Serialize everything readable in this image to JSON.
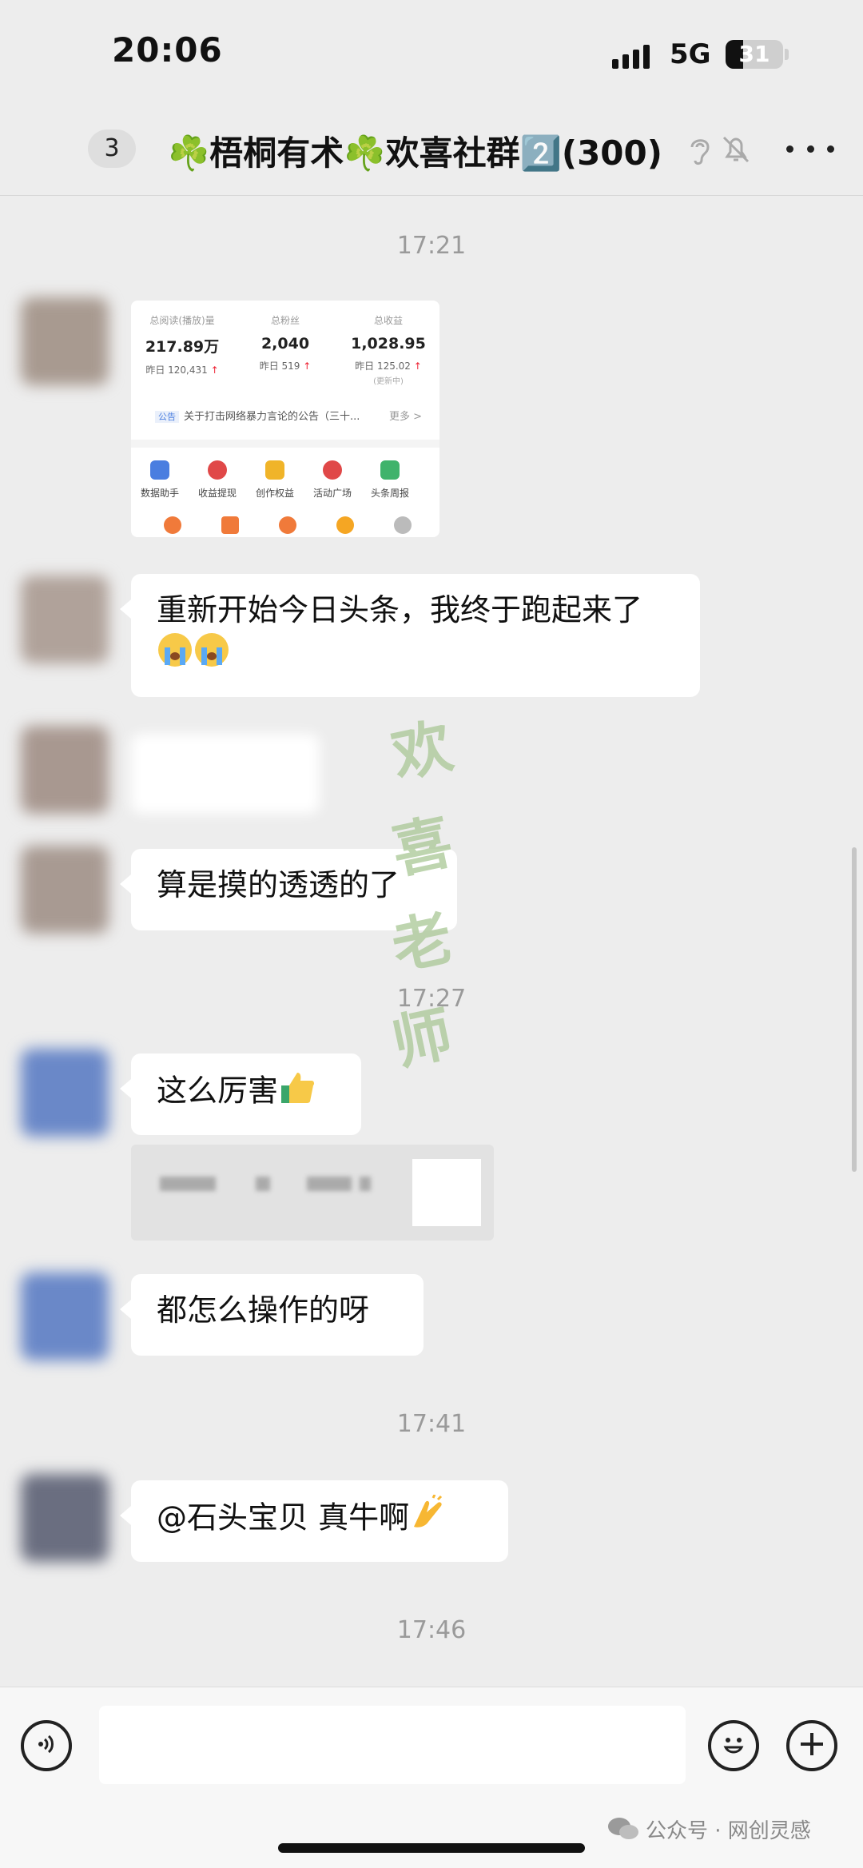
{
  "status_bar": {
    "time": "20:06",
    "network": "5G",
    "battery": "31",
    "battery_level": 0.31
  },
  "header": {
    "back_count": "3",
    "title": "☘️梧桐有术☘️欢喜社群2️⃣(300)"
  },
  "watermark": {
    "chars": [
      "欢",
      "喜",
      "老",
      "师"
    ]
  },
  "chat": {
    "timestamps": [
      "17:21",
      "17:27",
      "17:41",
      "17:46"
    ],
    "screenshot_card": {
      "stats": [
        {
          "label": "总阅读(播放)量",
          "value": "217.89万",
          "sub": "昨日 120,431",
          "note": ""
        },
        {
          "label": "总粉丝",
          "value": "2,040",
          "sub": "昨日 519",
          "note": ""
        },
        {
          "label": "总收益",
          "value": "1,028.95",
          "sub": "昨日 125.02",
          "note": "(更新中)"
        }
      ],
      "notice_tag": "公告",
      "notice_text": "关于打击网络暴力言论的公告（三十...",
      "notice_more": "更多 >",
      "tools": [
        "数据助手",
        "收益提现",
        "创作权益",
        "活动广场",
        "头条周报"
      ]
    },
    "messages": [
      {
        "text": "重新开始今日头条，我终于跑起来了"
      },
      {
        "text": "算是摸的透透的了"
      },
      {
        "text": "这么厉害"
      },
      {
        "text": "都怎么操作的呀"
      },
      {
        "text": "@石头宝贝 真牛啊"
      }
    ]
  },
  "input_bar": {
    "placeholder": ""
  },
  "footer": {
    "mark": "公众号 · 网创灵感"
  },
  "colors": {
    "background": "#ededed",
    "bubble": "#ffffff",
    "watermark": "#a9c795"
  },
  "icons": [
    "ear-icon",
    "mute-bell-icon",
    "more-icon",
    "voice-icon",
    "emoji-icon",
    "plus-icon",
    "wechat-icon",
    "crying-emoji",
    "thumbs-up-emoji",
    "clap-emoji"
  ]
}
